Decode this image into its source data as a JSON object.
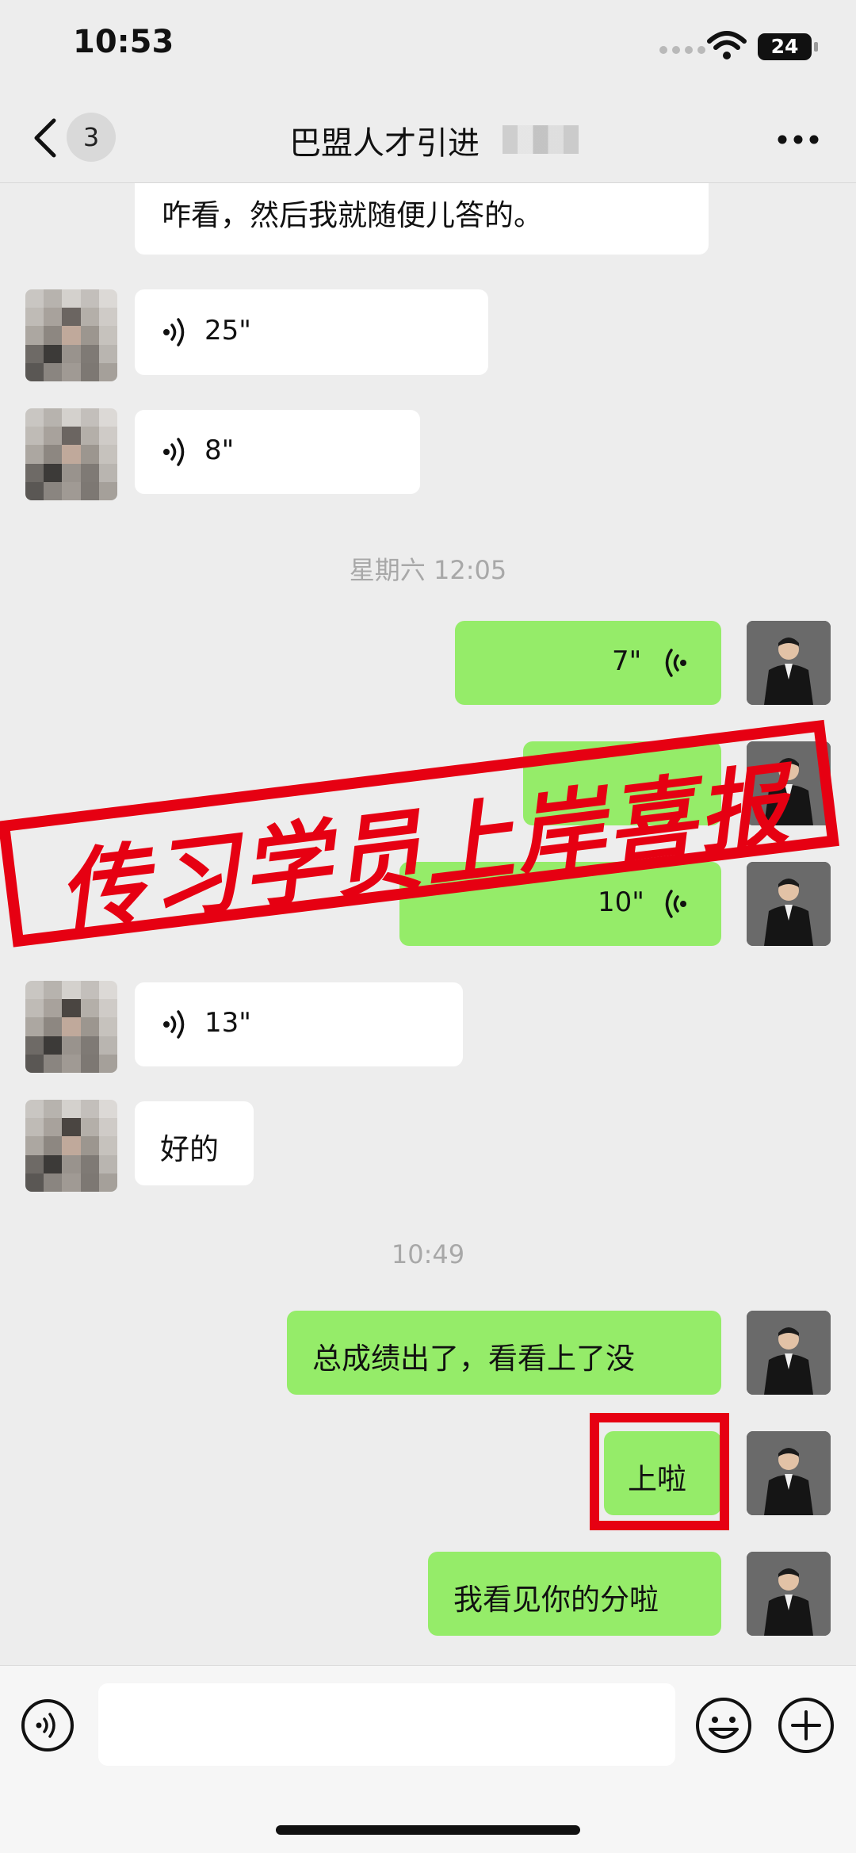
{
  "status_bar": {
    "time": "10:53",
    "battery": "24"
  },
  "nav": {
    "unread_count": "3",
    "title": "巴盟人才引进"
  },
  "messages": {
    "cut_off_text": "咋看，然后我就随便儿答的。",
    "voice_1": "25\"",
    "voice_2": "8\"",
    "timestamp_1": "星期六 12:05",
    "voice_3": "7\"",
    "voice_4": "10\"",
    "voice_5": "13\"",
    "text_ok": "好的",
    "timestamp_2": "10:49",
    "text_results": "总成绩出了，看看上了没",
    "text_passed": "上啦",
    "text_saw_score": "我看见你的分啦"
  },
  "stamp": {
    "text": "传习学员上岸喜报"
  },
  "input": {
    "placeholder": ""
  },
  "colors": {
    "sent_bubble": "#95ec69",
    "received_bubble": "#ffffff",
    "background": "#ededed",
    "stamp_red": "#e60012"
  }
}
